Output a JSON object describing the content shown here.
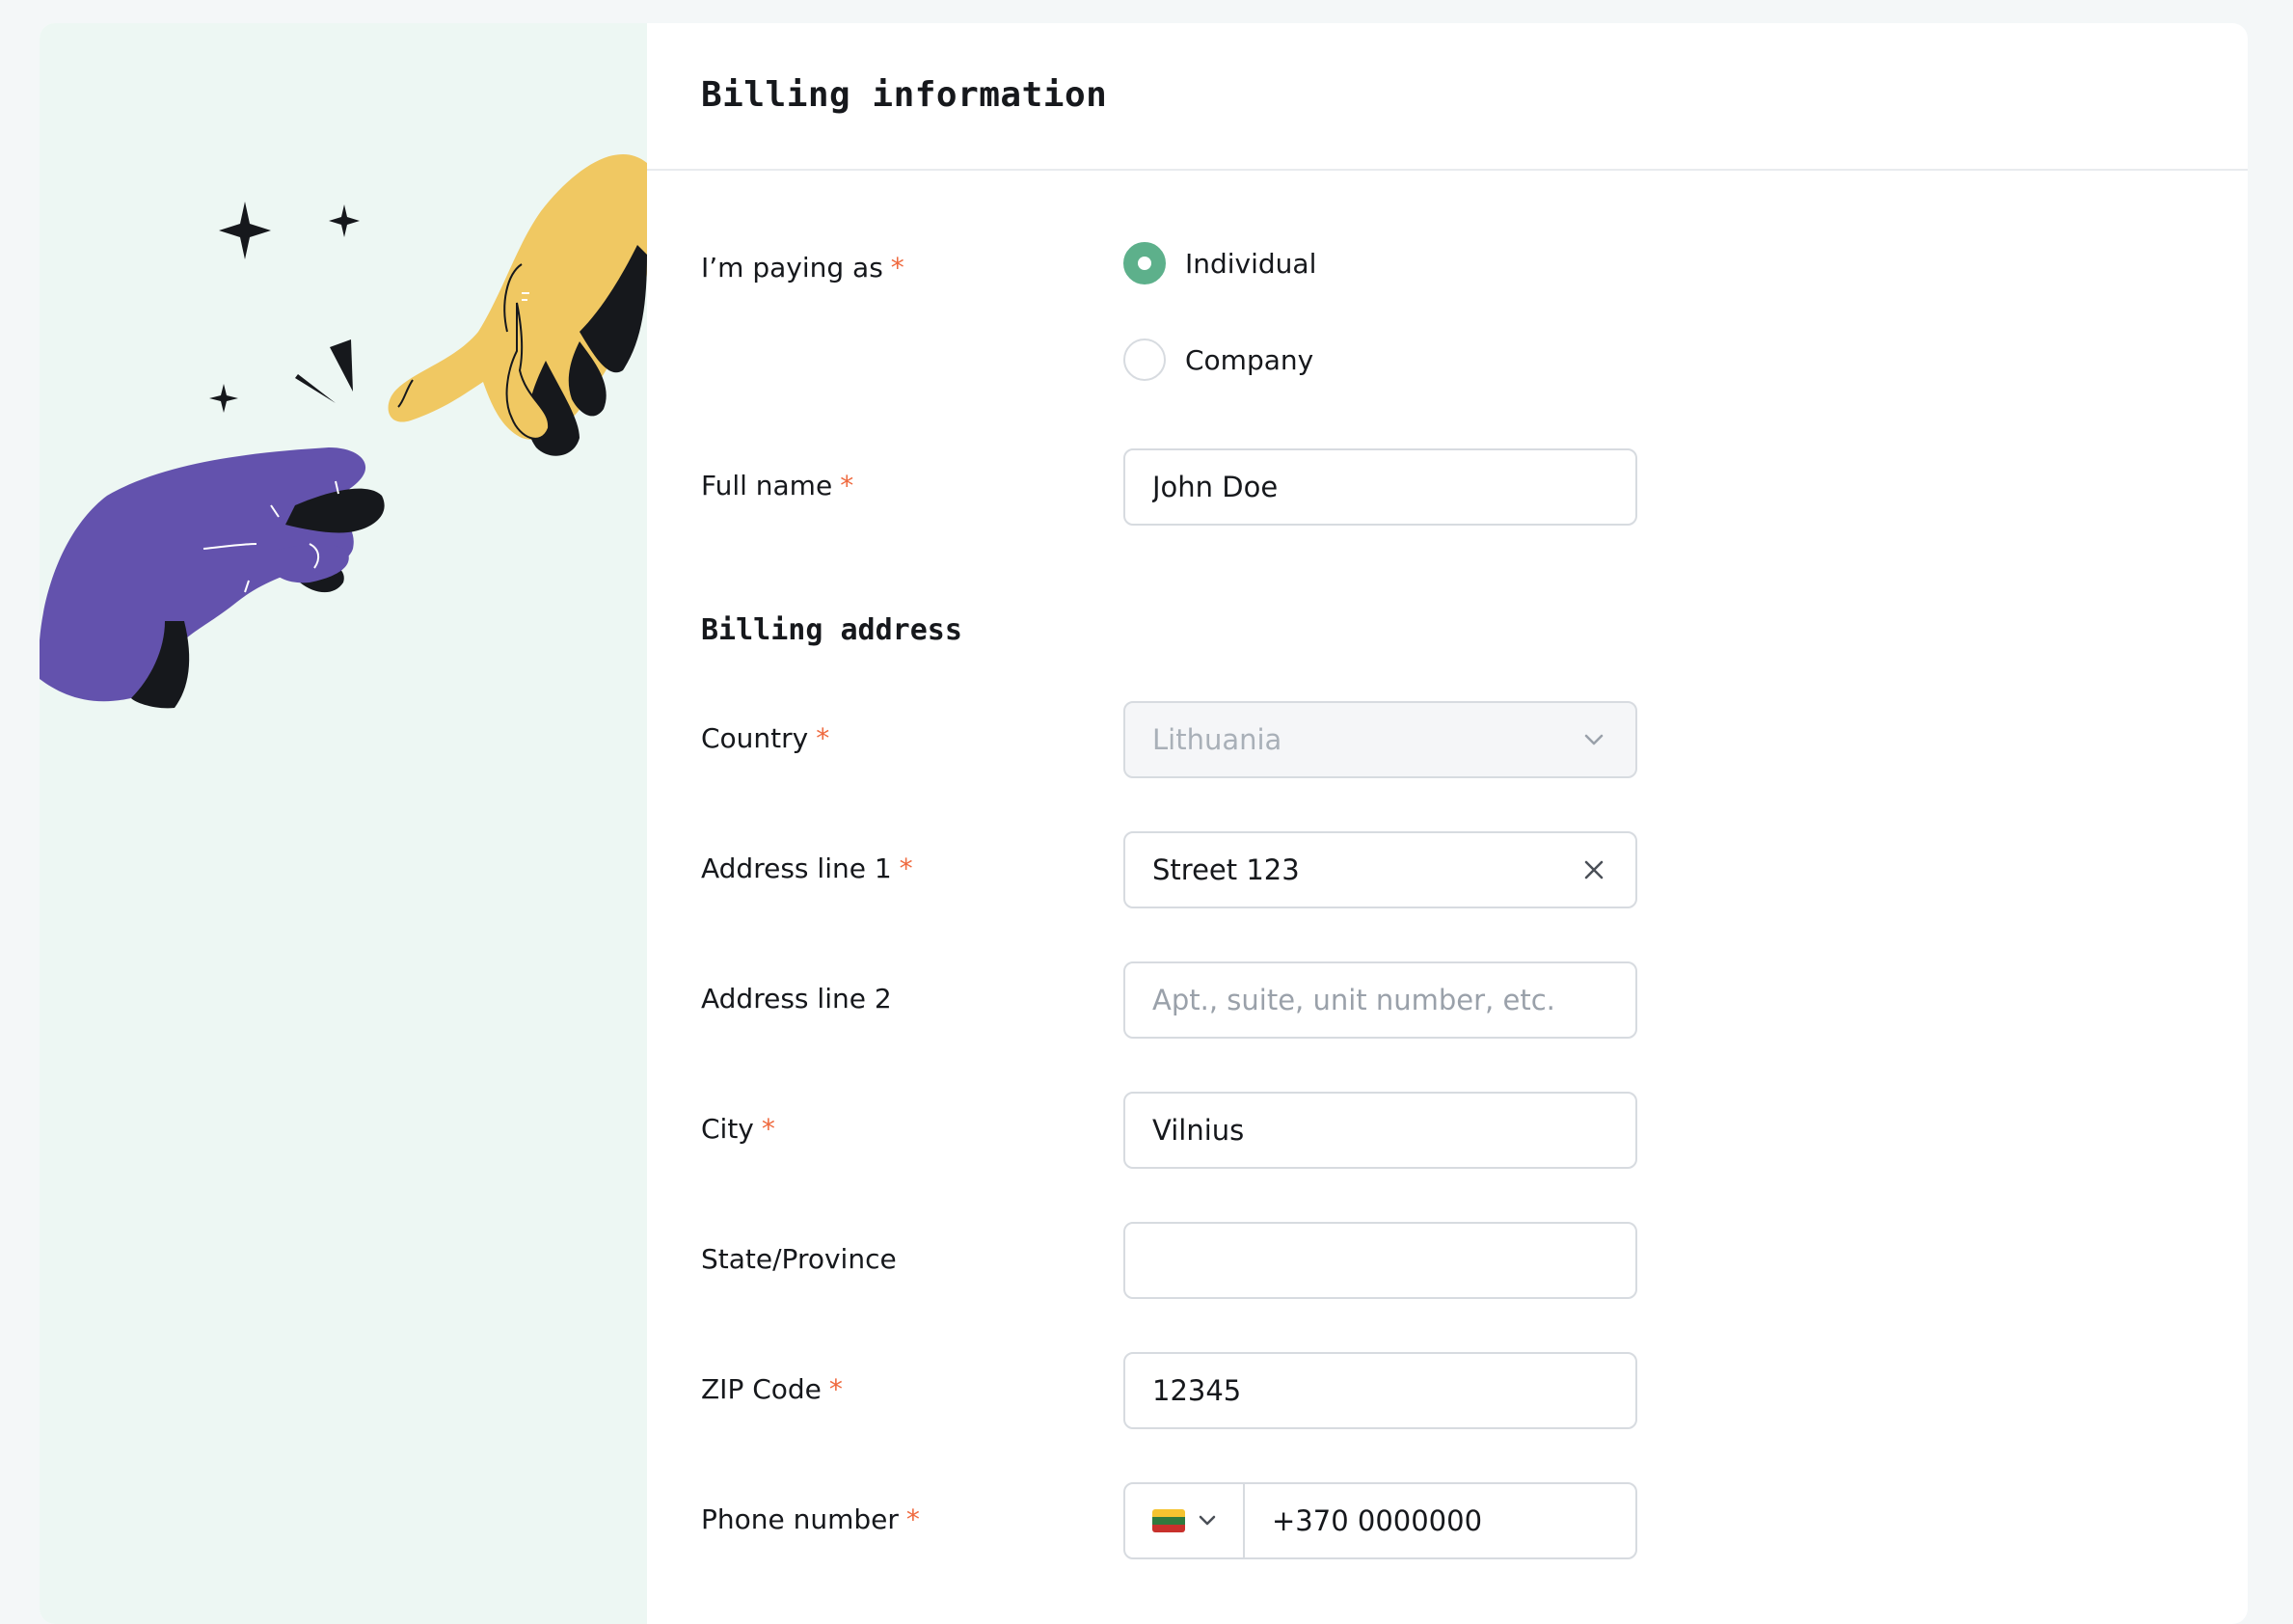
{
  "form": {
    "title": "Billing information",
    "paying_as": {
      "label": "I’m paying as",
      "required": "*",
      "options": [
        {
          "label": "Individual",
          "checked": true
        },
        {
          "label": "Company",
          "checked": false
        }
      ]
    },
    "full_name": {
      "label": "Full name",
      "required": "*",
      "value": "John Doe"
    },
    "billing_address": {
      "title": "Billing address",
      "country": {
        "label": "Country",
        "required": "*",
        "value": "Lithuania",
        "disabled": true,
        "icon": "chevron-down-icon"
      },
      "address1": {
        "label": "Address line 1",
        "required": "*",
        "value": "Street 123",
        "icon": "clear-icon"
      },
      "address2": {
        "label": "Address line 2",
        "placeholder": "Apt., suite, unit number, etc."
      },
      "city": {
        "label": "City",
        "required": "*",
        "value": "Vilnius"
      },
      "state": {
        "label": "State/Province",
        "value": ""
      },
      "zip": {
        "label": "ZIP Code",
        "required": "*",
        "value": "12345"
      },
      "phone": {
        "label": "Phone number",
        "required": "*",
        "country_flag": "lithuania-flag-icon",
        "value": "+370 0000000"
      }
    }
  },
  "colors": {
    "accent": "#5db08b",
    "required": "#ef6a3f",
    "illustration_bg": "#edf7f3",
    "hand_yellow": "#f0c862",
    "hand_purple": "#6352ad"
  },
  "illustration": {
    "icon": "reaching-hands-illustration"
  }
}
